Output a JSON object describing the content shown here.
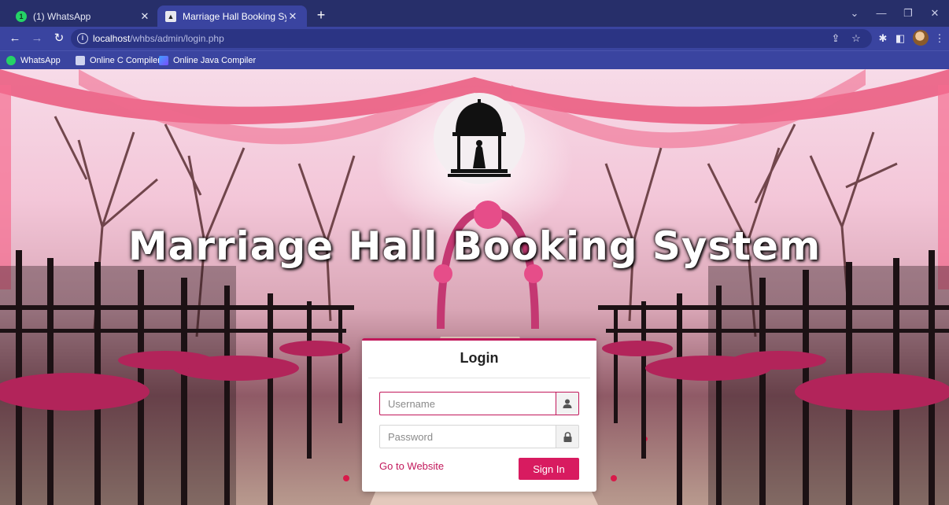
{
  "browser": {
    "tabs": [
      {
        "title": "(1) WhatsApp",
        "badge": "1",
        "favicon": "whatsapp-icon"
      },
      {
        "title": "Marriage Hall Booking System",
        "favicon": "hall-icon"
      }
    ],
    "new_tab_label": "+",
    "url_host": "localhost",
    "url_path": "/whbs/admin/login.php",
    "bookmarks": [
      {
        "label": "WhatsApp",
        "icon": "whatsapp-icon"
      },
      {
        "label": "Online C Compiler",
        "icon": "compiler-icon"
      },
      {
        "label": "Online Java Compiler",
        "icon": "java-icon"
      }
    ]
  },
  "page": {
    "hero_title": "Marriage Hall Booking System",
    "login": {
      "title": "Login",
      "username_placeholder": "Username",
      "password_placeholder": "Password",
      "goto_link": "Go to Website",
      "signin_label": "Sign In"
    }
  },
  "colors": {
    "chrome_dark": "#272f6a",
    "chrome": "#3a44a0",
    "accent": "#c2185b",
    "button": "#d81b60"
  }
}
